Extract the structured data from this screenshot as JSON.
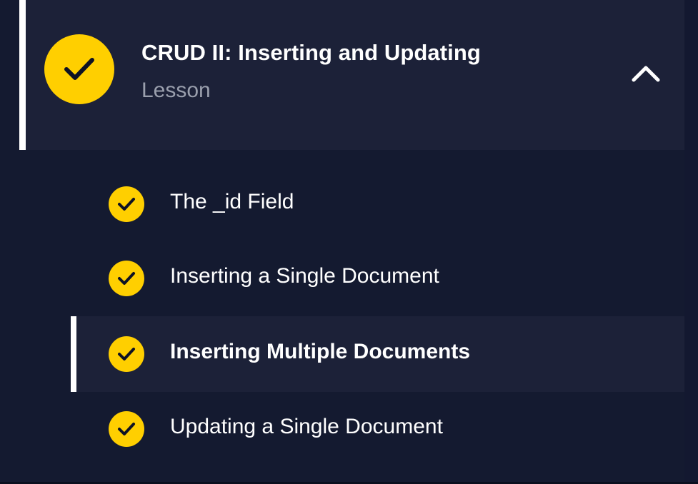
{
  "lesson": {
    "title": "CRUD II: Inserting and Updating",
    "type_label": "Lesson",
    "status_icon": "check-icon",
    "expanded": true,
    "toggle_icon": "chevron-up-icon"
  },
  "items": [
    {
      "label": "The _id Field",
      "completed": true,
      "active": false
    },
    {
      "label": "Inserting a Single Document",
      "completed": true,
      "active": false
    },
    {
      "label": "Inserting Multiple Documents",
      "completed": true,
      "active": true
    },
    {
      "label": "Updating a Single Document",
      "completed": true,
      "active": false
    }
  ],
  "colors": {
    "background": "#141a30",
    "panel": "#1c2138",
    "accent": "#ffcf00",
    "text": "#ffffff",
    "muted_text": "#9a9fad"
  }
}
